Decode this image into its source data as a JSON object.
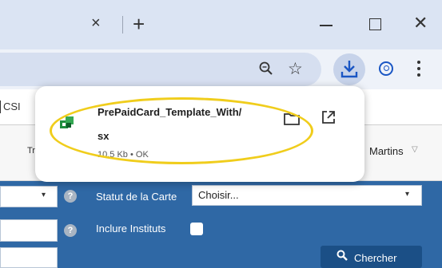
{
  "window": {
    "tab_close_glyph": "×",
    "new_tab_glyph": "+",
    "close_glyph": "✕"
  },
  "toolbar": {
    "icons": [
      "zoom-icon",
      "bookmark-star-icon",
      "download-icon",
      "profile-icon",
      "more-menu-icon"
    ]
  },
  "page": {
    "tab_fragment": "CSI",
    "nav_fragment": "Tr",
    "user_name": "Martins",
    "user_caret": "▽"
  },
  "search_form": {
    "help_glyph": "?",
    "statut_label": "Statut de la Carte",
    "statut_value": "Choisir...",
    "caret_glyph": "▾",
    "inclure_label": "Inclure Instituts",
    "search_button_icon": "🔍",
    "search_button_label": "Chercher"
  },
  "download": {
    "file_name_line1": "PrePaidCard_Template_With/",
    "file_name_line2": "sx",
    "file_meta": "10,5 Kb • OK"
  },
  "colors": {
    "titlebar": "#dbe4f3",
    "download_button_bg": "#c7d3ea",
    "accent_blue": "#1a56c4",
    "form_blue": "#2f68a5",
    "highlight": "#f0cd1c"
  }
}
